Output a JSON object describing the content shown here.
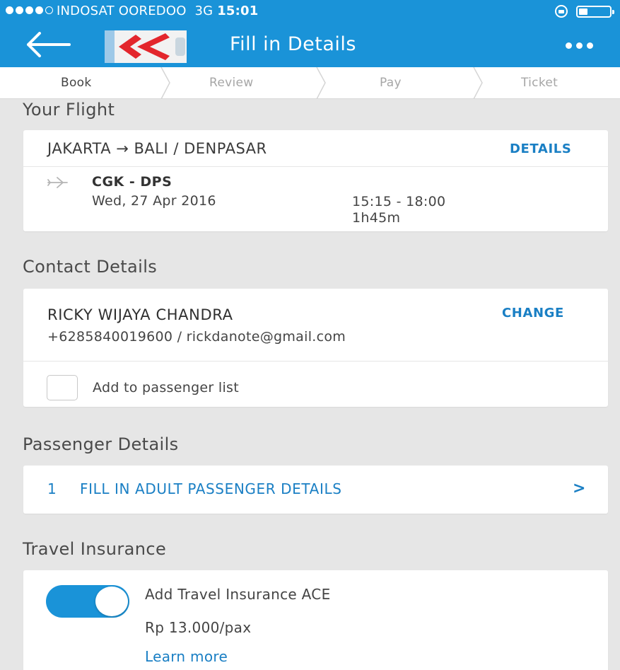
{
  "status_bar": {
    "carrier": "INDOSAT OOREDOO",
    "network": "3G",
    "time": "15:01"
  },
  "header": {
    "title": "Fill in Details",
    "back_icon": "back-arrow-icon",
    "menu_icon": "more-dots-icon"
  },
  "steps": [
    {
      "label": "Book",
      "active": true
    },
    {
      "label": "Review",
      "active": false
    },
    {
      "label": "Pay",
      "active": false
    },
    {
      "label": "Ticket",
      "active": false
    }
  ],
  "flight": {
    "section_title": "Your Flight",
    "route": "JAKARTA → BALI / DENPASAR",
    "details_label": "DETAILS",
    "codes": "CGK - DPS",
    "date": "Wed, 27 Apr 2016",
    "time": "15:15 - 18:00",
    "duration": "1h45m"
  },
  "contact": {
    "section_title": "Contact Details",
    "name": "RICKY WIJAYA CHANDRA",
    "change_label": "CHANGE",
    "info": "+6285840019600 / rickdanote@gmail.com",
    "add_passenger_label": "Add to passenger list",
    "add_passenger_checked": false
  },
  "passenger": {
    "section_title": "Passenger Details",
    "number": "1",
    "label": "FILL IN ADULT PASSENGER DETAILS",
    "chevron": ">"
  },
  "insurance": {
    "section_title": "Travel Insurance",
    "toggle_on": true,
    "label": "Add Travel Insurance ACE",
    "price": "Rp 13.000/pax",
    "learn_more": "Learn more"
  },
  "colors": {
    "primary": "#1a93d8",
    "link": "#1a7fc4",
    "background": "#e6e6e6"
  }
}
